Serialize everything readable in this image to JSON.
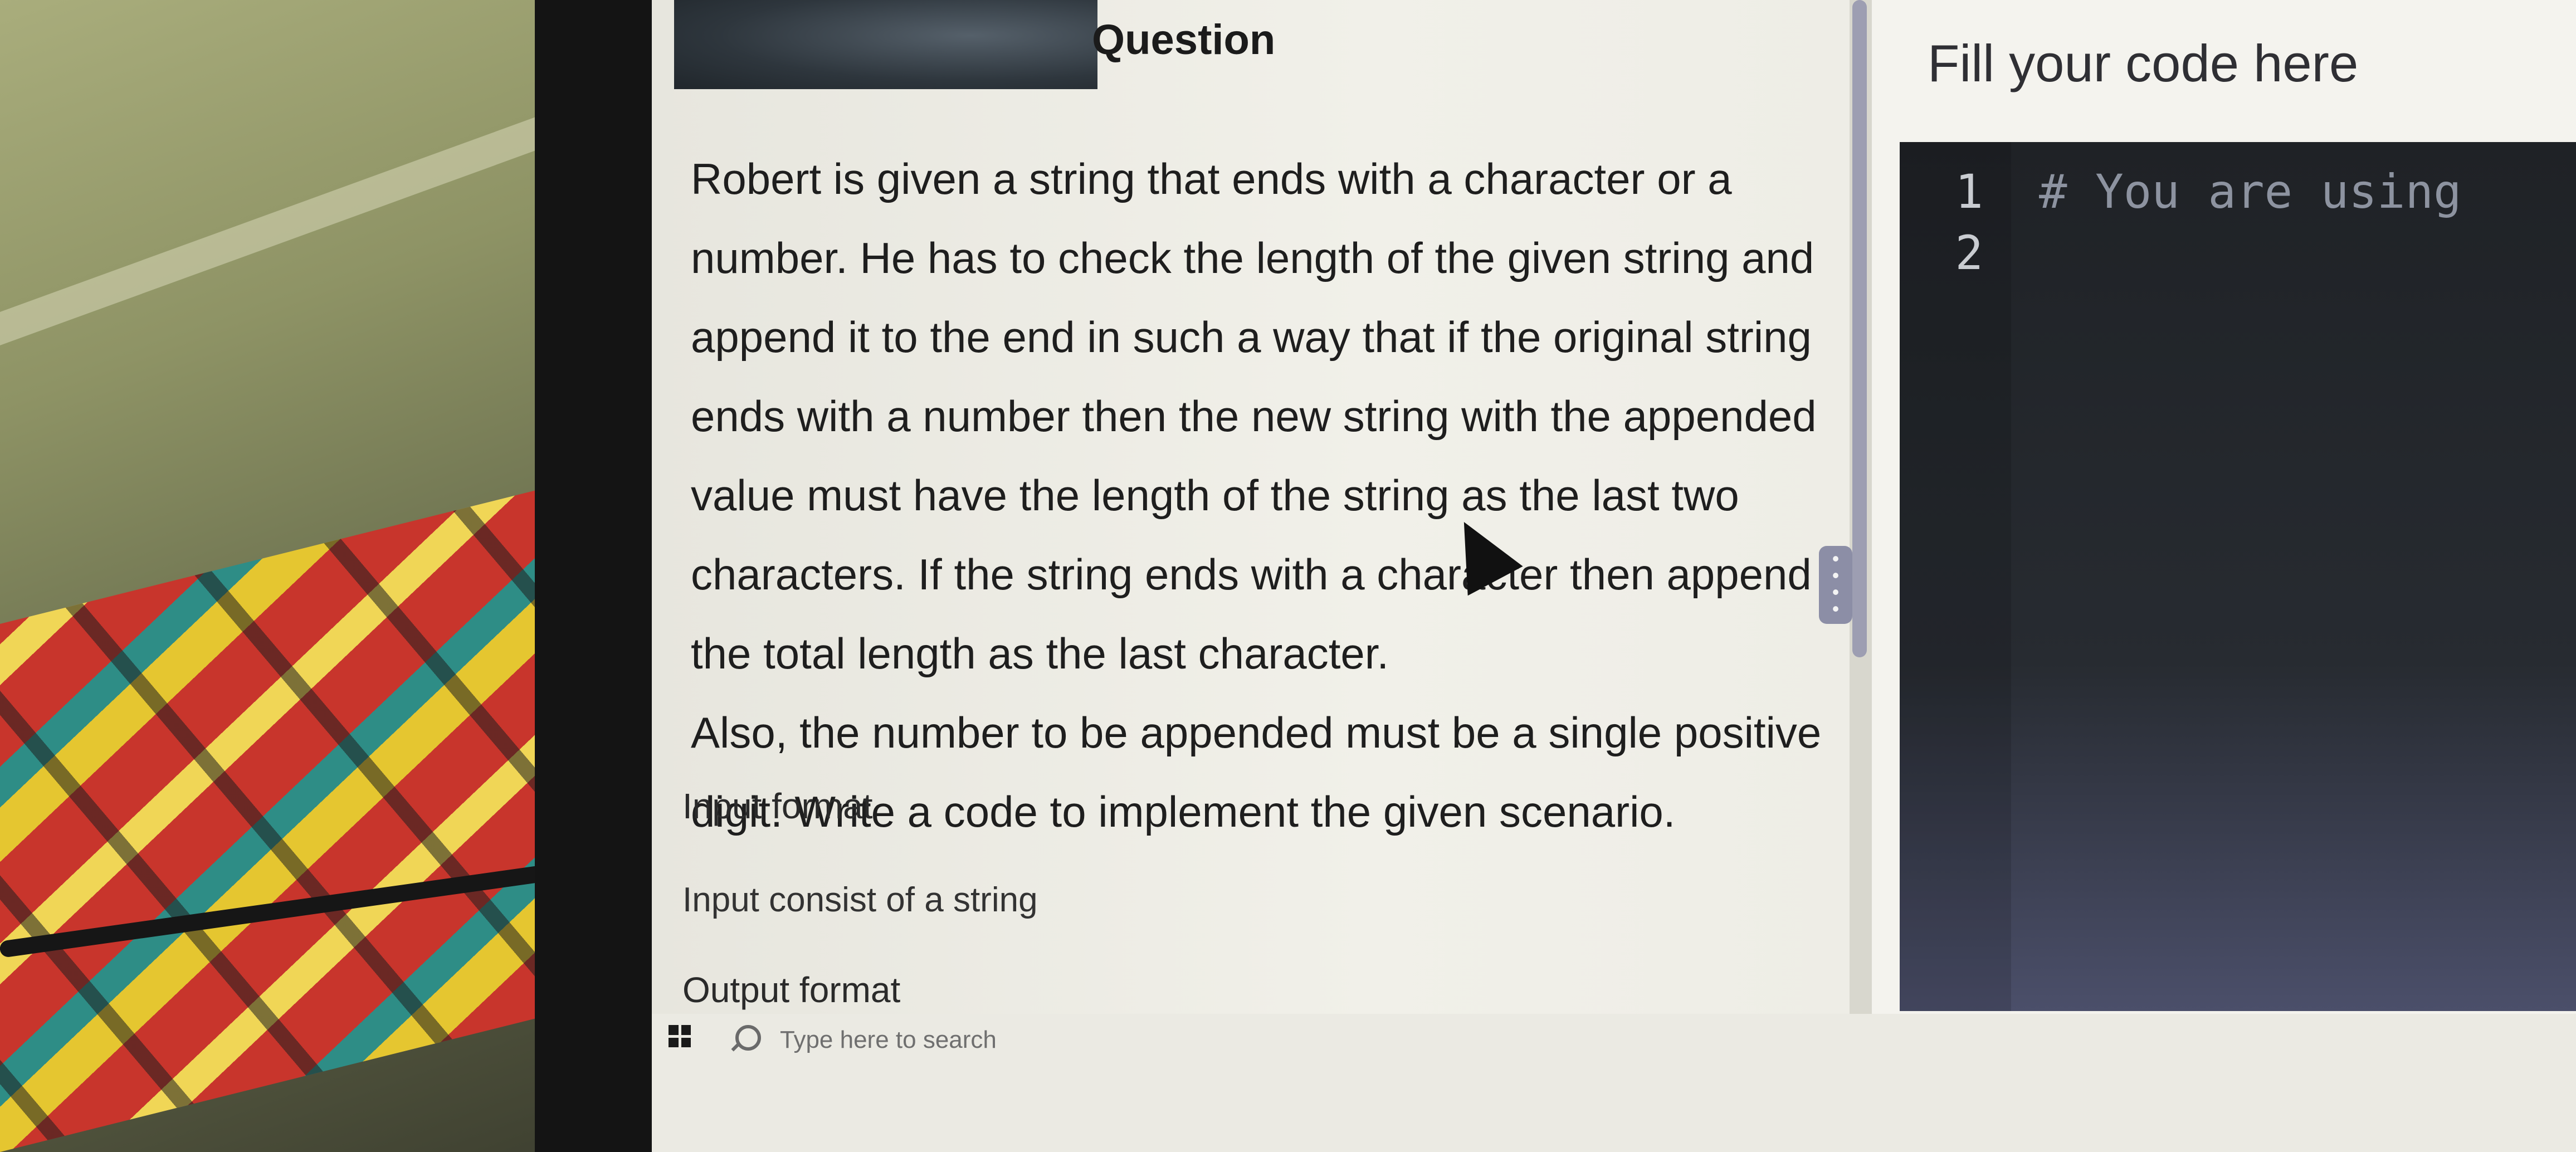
{
  "question": {
    "title": "Question",
    "lines": [
      "Robert is given a string that ends with a character or a",
      "number. He has to check the length of the given string and",
      "append it to the end in such a way that if the original string",
      "ends with a number then the new string with the appended",
      "value must have the length of the string as the last two",
      "characters. If the string ends with a character then append",
      "the total length as the last character.",
      "Also, the number to be appended must be a single positive",
      "digit. Write a code to implement the given scenario."
    ],
    "input_format_label": "Input format",
    "input_format_text": "Input consist of a string",
    "output_format_label": "Output format"
  },
  "editor": {
    "title": "Fill your code here",
    "line_numbers": [
      "1",
      "2"
    ],
    "lines": [
      "# You are using",
      ""
    ]
  },
  "taskbar": {
    "search_placeholder": "Type here to search"
  },
  "icons": {
    "start": "windows-start-icon",
    "search": "search-icon",
    "cursor": "mouse-pointer-icon",
    "splitter": "drag-handle-icon"
  },
  "colors": {
    "editor_bg": "#272b31",
    "splitter": "#9d9eb2"
  }
}
